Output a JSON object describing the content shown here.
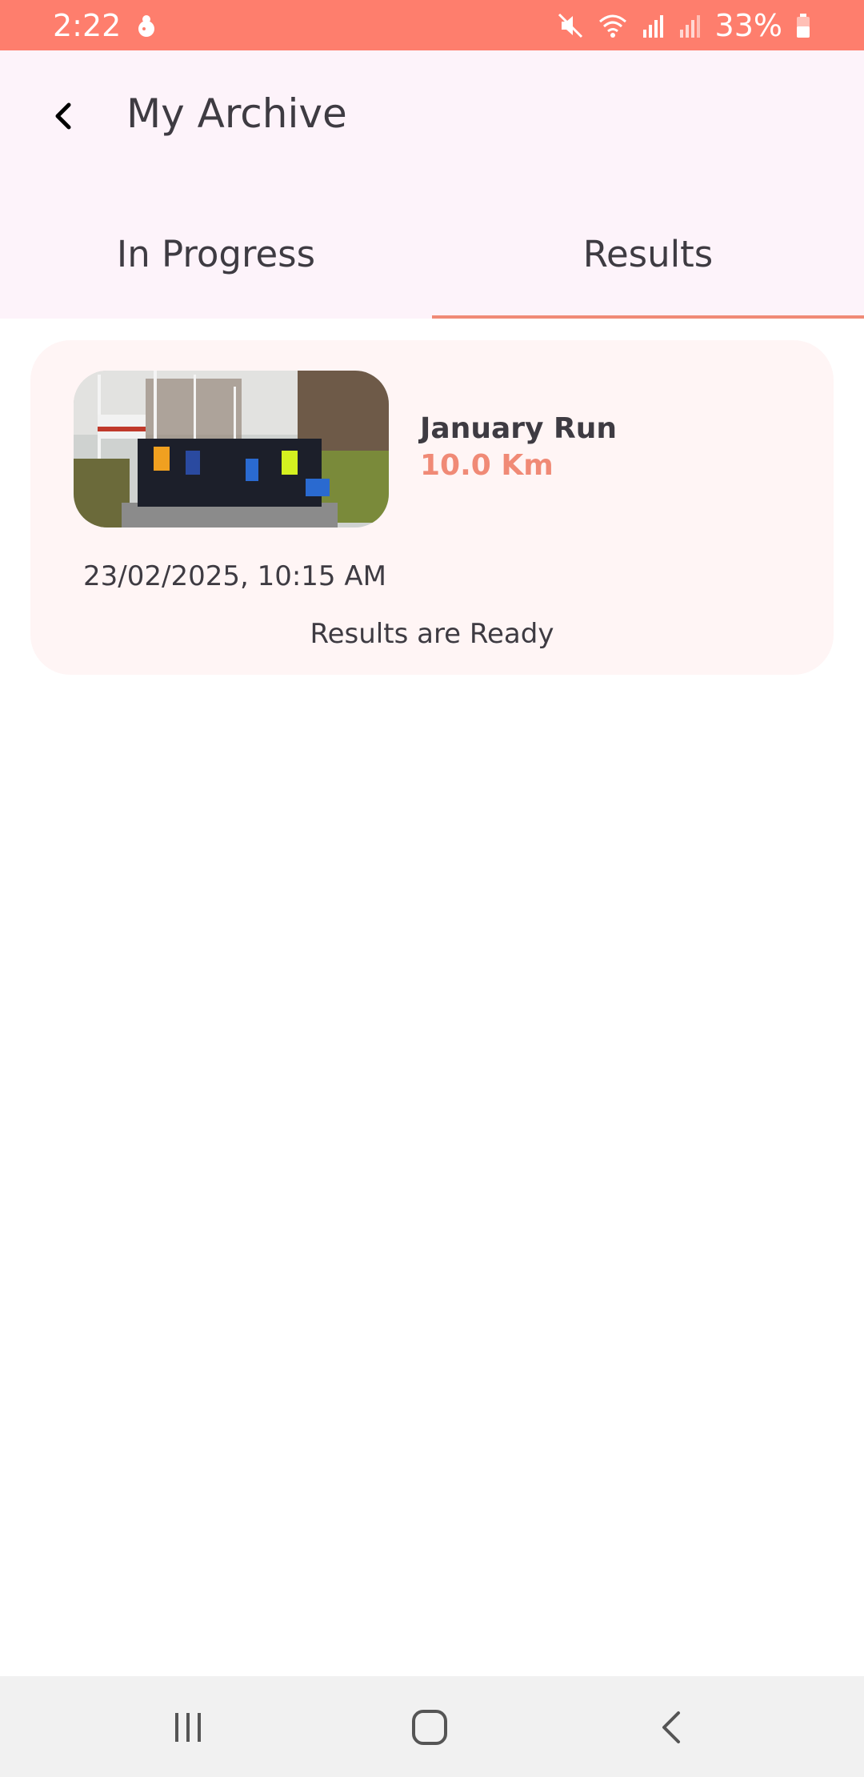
{
  "status_bar": {
    "time": "2:22",
    "battery": "33%"
  },
  "header": {
    "title": "My Archive"
  },
  "tabs": [
    {
      "label": "In Progress",
      "active": false
    },
    {
      "label": "Results",
      "active": true
    }
  ],
  "results": [
    {
      "name": "January Run",
      "distance": "10.0 Km",
      "datetime": "23/02/2025, 10:15 AM",
      "status": "Results are Ready"
    }
  ],
  "colors": {
    "status_bar": "#fe7e6d",
    "accent": "#f08a76",
    "header_bg": "#fdf3fa",
    "card_bg": "#fff5f5",
    "text": "#3e3b42"
  },
  "icons": {
    "status_left": [
      "mascot-icon"
    ],
    "status_right": [
      "mute-icon",
      "wifi-icon",
      "signal-icon",
      "signal-icon-2",
      "battery-icon"
    ],
    "toolbar": "back-arrow-icon",
    "nav": [
      "recent-apps-icon",
      "home-icon",
      "back-icon"
    ]
  }
}
